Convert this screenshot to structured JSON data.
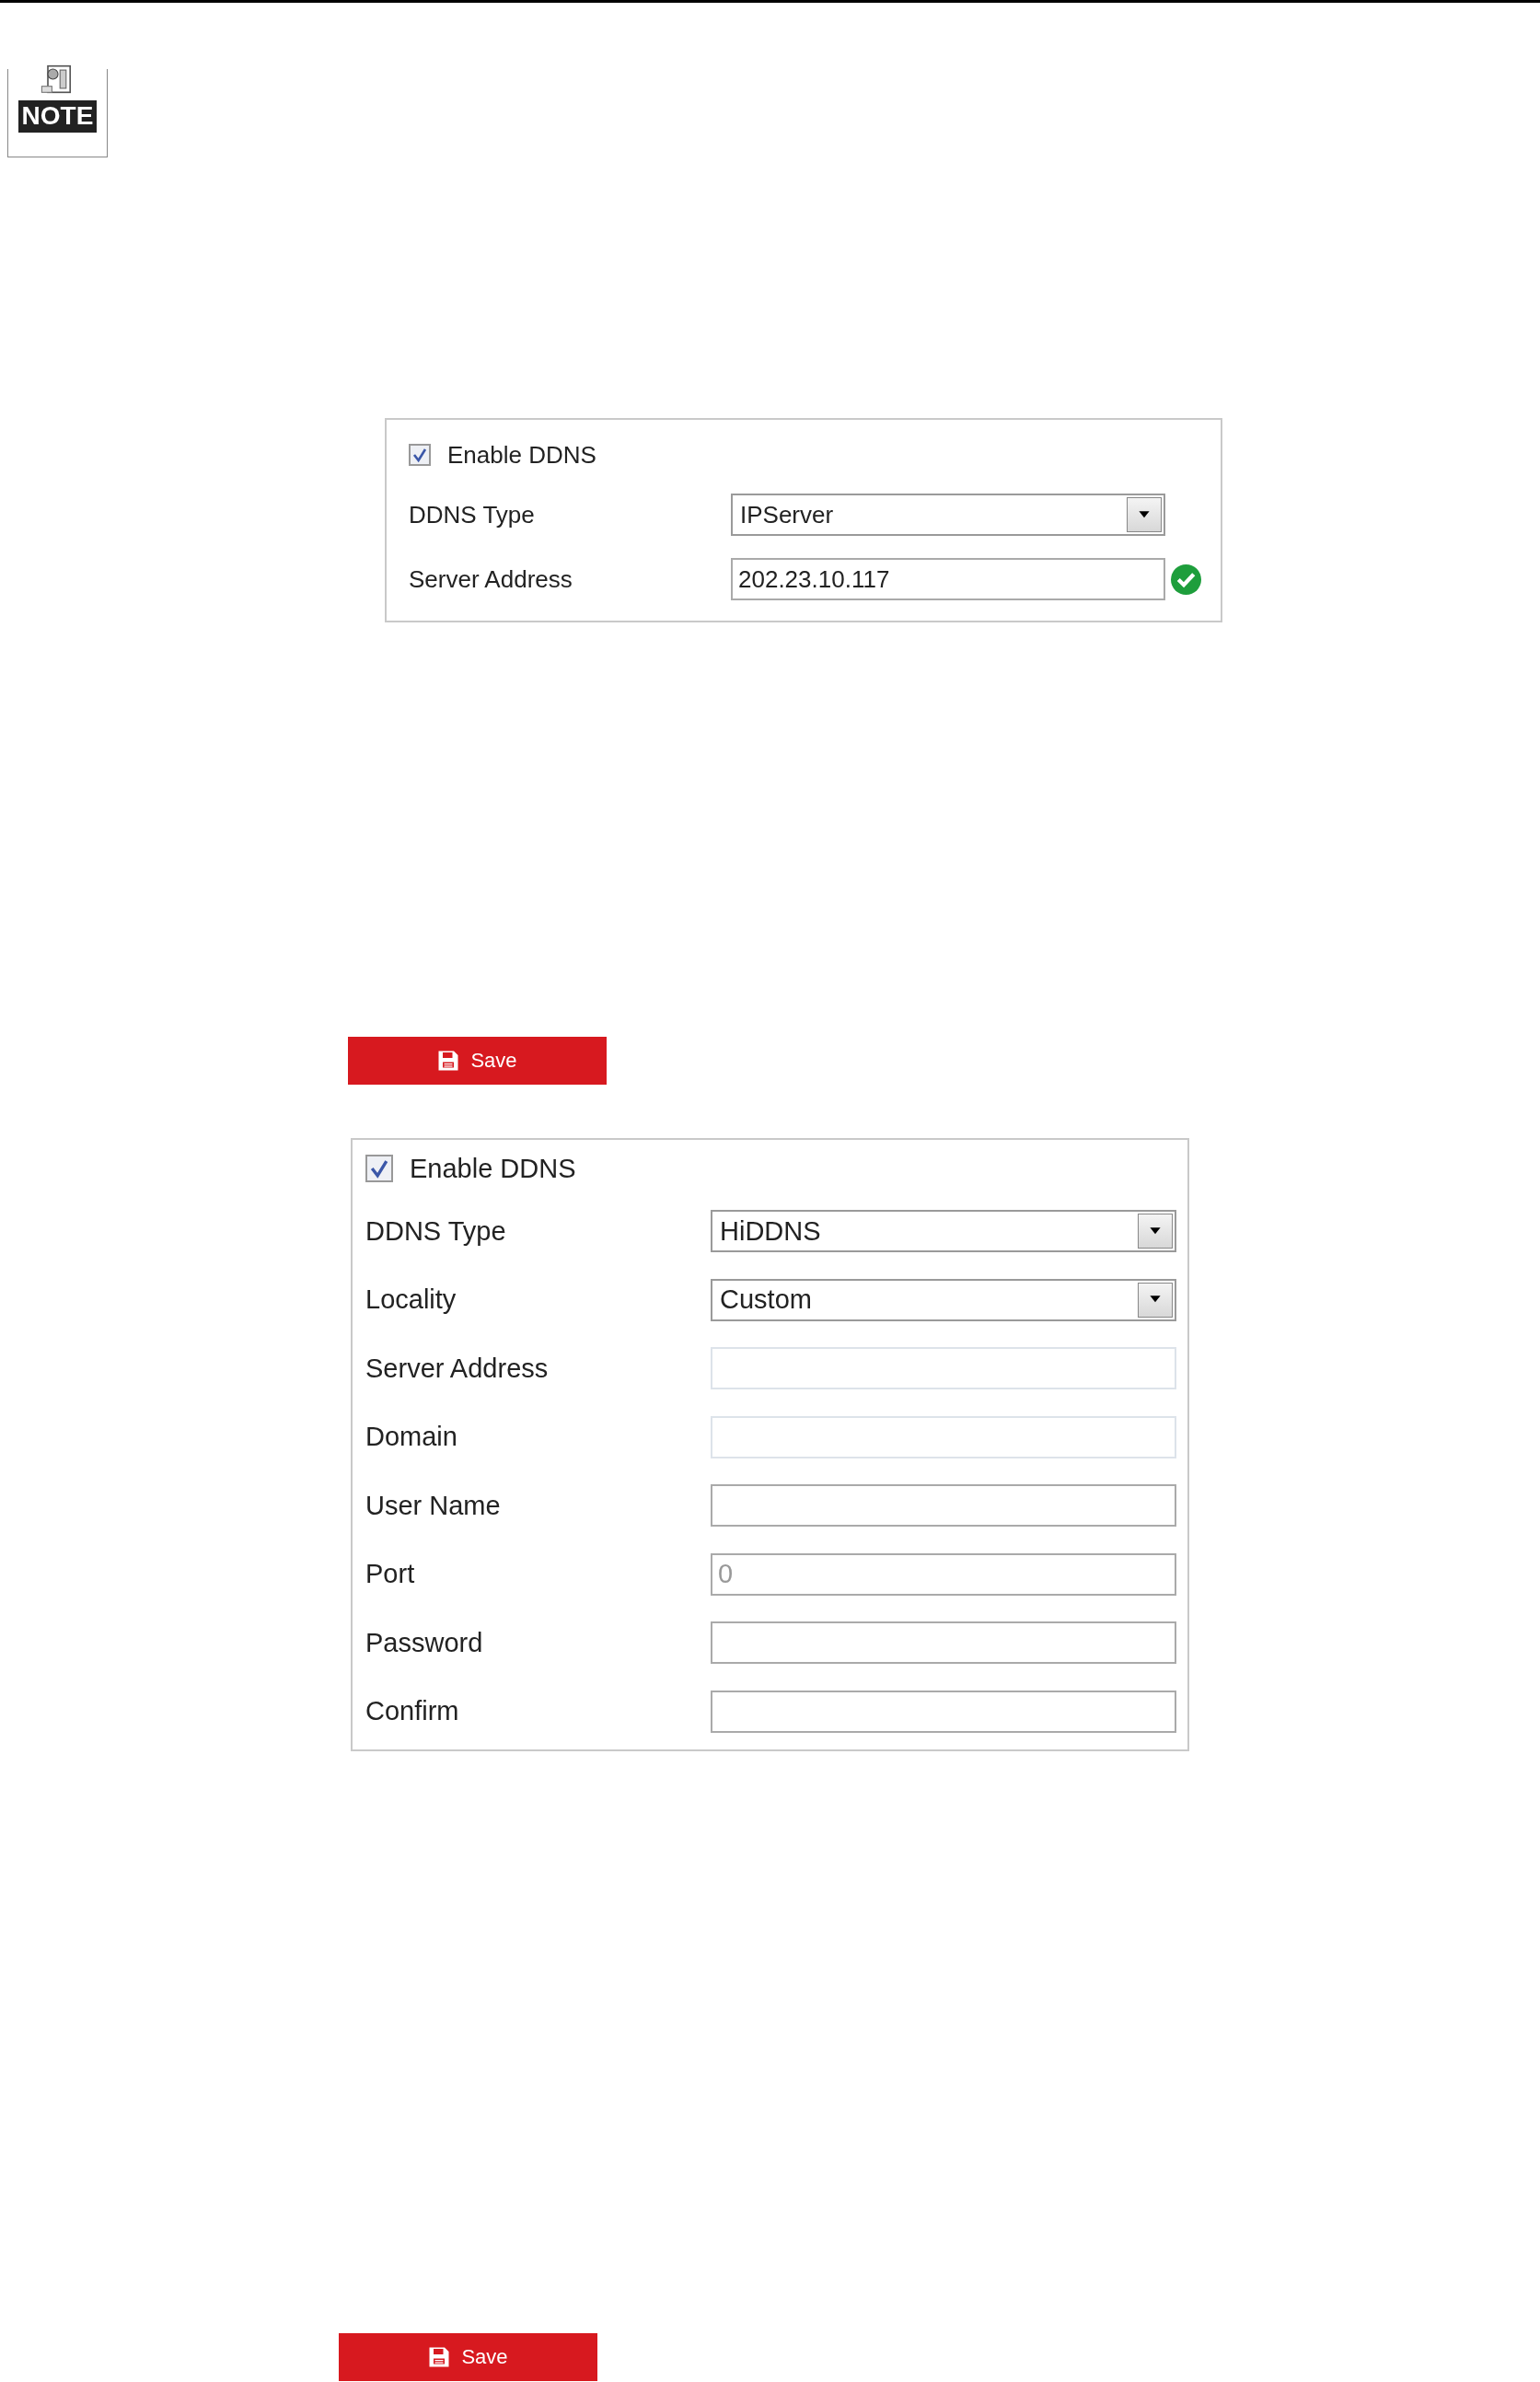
{
  "note_badge": {
    "label": "NOTE"
  },
  "sections": [
    {
      "panel": {
        "enable": {
          "label": "Enable DDNS",
          "checked": true
        },
        "rows": [
          {
            "label": "DDNS Type",
            "kind": "select",
            "value": "IPServer"
          },
          {
            "label": "Server Address",
            "kind": "text",
            "value": "202.23.10.117",
            "valid": true,
            "disabled": false
          }
        ]
      },
      "save_button": "Save"
    },
    {
      "panel": {
        "enable": {
          "label": "Enable DDNS",
          "checked": true
        },
        "rows": [
          {
            "label": "DDNS Type",
            "kind": "select",
            "value": "HiDDNS"
          },
          {
            "label": "Locality",
            "kind": "select",
            "value": "Custom"
          },
          {
            "label": "Server Address",
            "kind": "text",
            "disabled": true
          },
          {
            "label": "Domain",
            "kind": "text",
            "disabled": true
          },
          {
            "label": "User Name",
            "kind": "text",
            "disabled": false
          },
          {
            "label": "Port",
            "kind": "text",
            "placeholder": "0",
            "disabled": false
          },
          {
            "label": "Password",
            "kind": "text",
            "disabled": false
          },
          {
            "label": "Confirm",
            "kind": "text",
            "disabled": false
          }
        ]
      },
      "save_button": "Save"
    }
  ]
}
